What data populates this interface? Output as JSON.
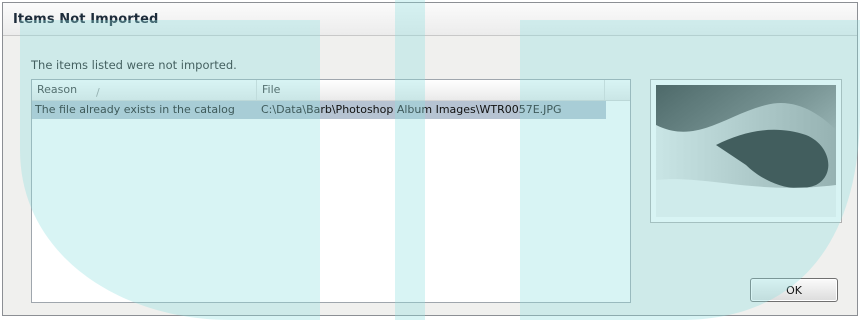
{
  "dialog": {
    "title": "Items Not Imported",
    "message": "The items listed were not imported."
  },
  "list": {
    "columns": [
      {
        "label": "Reason"
      },
      {
        "label": "File"
      }
    ],
    "rows": [
      {
        "reason": "The file already exists in the catalog",
        "file": "C:\\Data\\Barb\\Photoshop Album Images\\WTR0057E.JPG"
      }
    ]
  },
  "buttons": {
    "ok_label": "OK"
  },
  "colors": {
    "selected_row": "#b6c3d2",
    "watermark": "#8fe0e0"
  }
}
